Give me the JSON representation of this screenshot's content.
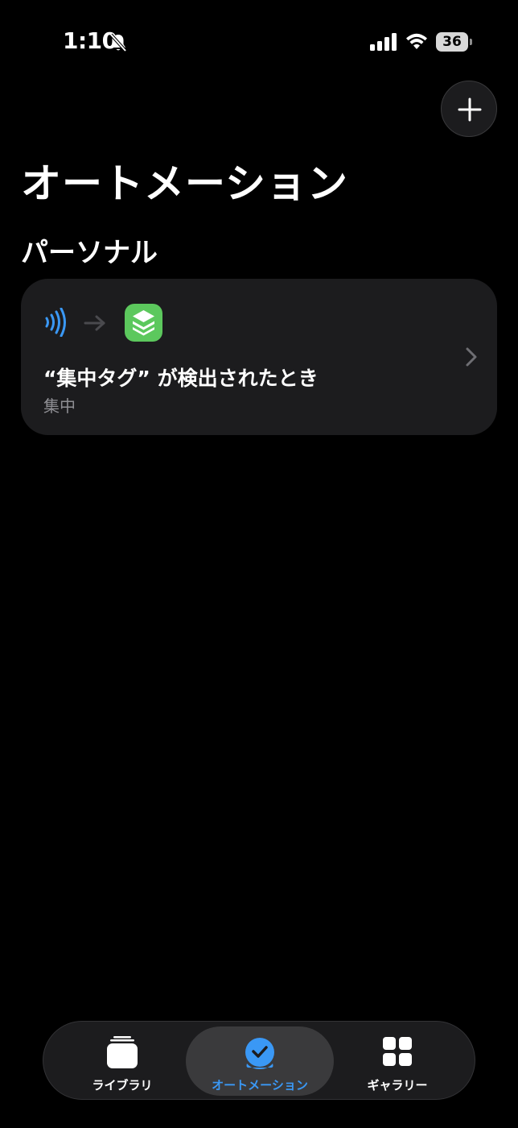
{
  "status_bar": {
    "time": "1:10",
    "battery_level": "36",
    "icons": [
      "bell-slash-icon",
      "cellular-signal-icon",
      "wifi-icon",
      "battery-icon"
    ]
  },
  "header": {
    "add_button_icon": "plus-icon",
    "title": "オートメーション"
  },
  "section": {
    "title": "パーソナル"
  },
  "automations": [
    {
      "trigger_icon": "nfc-icon",
      "arrow_icon": "arrow-right-icon",
      "app_icon": "focus-app-icon",
      "title": "“集中タグ” が検出されたとき",
      "subtitle": "集中"
    }
  ],
  "tab_bar": {
    "tabs": [
      {
        "label": "ライブラリ",
        "icon": "library-stack-icon",
        "selected": false
      },
      {
        "label": "オートメーション",
        "icon": "automation-clock-icon",
        "selected": true
      },
      {
        "label": "ギャラリー",
        "icon": "gallery-grid-icon",
        "selected": false
      }
    ]
  },
  "colors": {
    "background": "#000000",
    "card": "#1c1c1e",
    "accent_blue": "#3a98f5",
    "focus_green": "#5cc85d",
    "secondary_text": "#8e8e93"
  }
}
